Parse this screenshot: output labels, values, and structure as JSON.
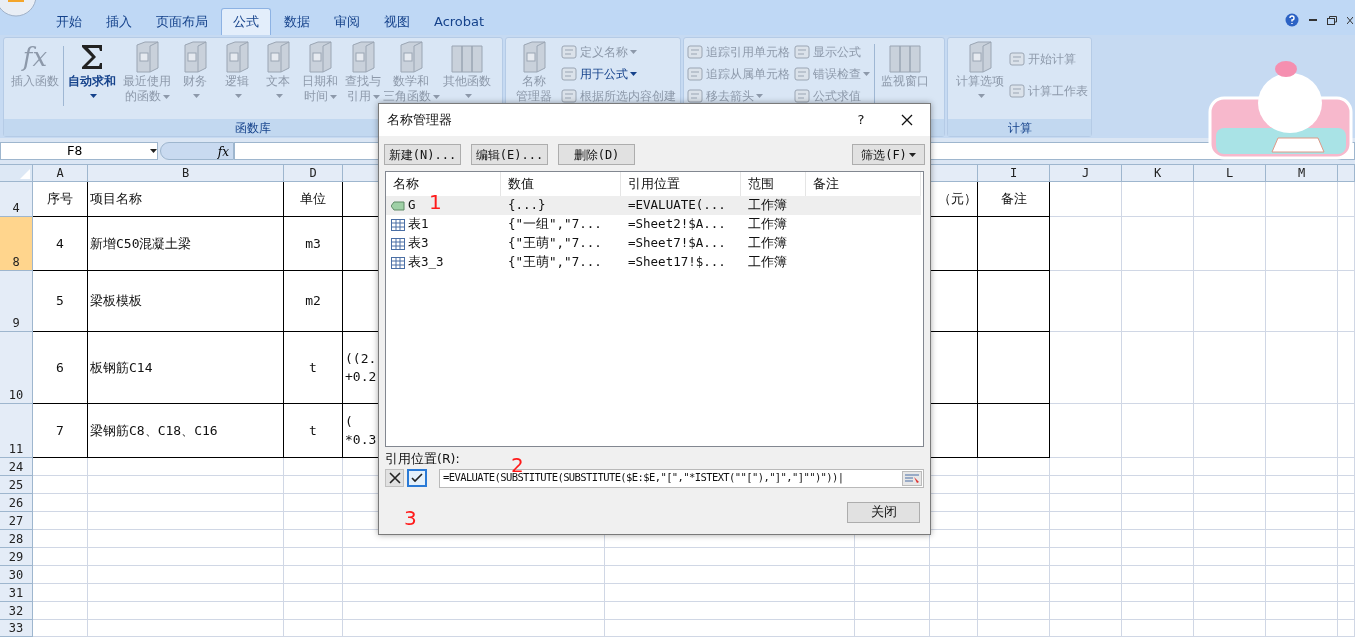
{
  "tabs": [
    {
      "label": "开始",
      "selected": false
    },
    {
      "label": "插入",
      "selected": false
    },
    {
      "label": "页面布局",
      "selected": false
    },
    {
      "label": "公式",
      "selected": true
    },
    {
      "label": "数据",
      "selected": false
    },
    {
      "label": "审阅",
      "selected": false
    },
    {
      "label": "视图",
      "selected": false
    },
    {
      "label": "Acrobat",
      "selected": false
    }
  ],
  "ribbon": {
    "library": {
      "label": "函数库",
      "buttons": [
        {
          "kind": "fx",
          "glyph": "fx",
          "lines": [
            "插入函数"
          ],
          "dropdown": false,
          "disabled": true
        },
        {
          "kind": "sigma",
          "lines": [
            "自动求和"
          ],
          "dropdown": true,
          "disabled": false
        },
        {
          "kind": "book",
          "lines": [
            "最近使用",
            "的函数"
          ],
          "dropdown": true,
          "disabled": true
        },
        {
          "kind": "book",
          "lines": [
            "财务"
          ],
          "dropdown": true,
          "disabled": true
        },
        {
          "kind": "book",
          "lines": [
            "逻辑"
          ],
          "dropdown": true,
          "disabled": true
        },
        {
          "kind": "book",
          "lines": [
            "文本"
          ],
          "dropdown": true,
          "disabled": true
        },
        {
          "kind": "book",
          "lines": [
            "日期和",
            "时间"
          ],
          "dropdown": true,
          "disabled": true
        },
        {
          "kind": "book",
          "lines": [
            "查找与",
            "引用"
          ],
          "dropdown": true,
          "disabled": true
        },
        {
          "kind": "book",
          "lines": [
            "数学和",
            "三角函数"
          ],
          "dropdown": true,
          "disabled": true
        },
        {
          "kind": "books",
          "lines": [
            "其他函数"
          ],
          "dropdown": true,
          "disabled": true
        }
      ]
    },
    "names": {
      "big": {
        "lines": [
          "名称",
          "管理器"
        ],
        "disabled": true
      },
      "items": [
        {
          "label": "定义名称",
          "dropdown": true,
          "disabled": true
        },
        {
          "label": "用于公式",
          "dropdown": true,
          "disabled": false
        },
        {
          "label": "根据所选内容创建",
          "dropdown": false,
          "disabled": true
        }
      ]
    },
    "audit": {
      "columns": [
        [
          {
            "label": "追踪引用单元格",
            "dropdown": false
          },
          {
            "label": "追踪从属单元格",
            "dropdown": false
          },
          {
            "label": "移去箭头",
            "dropdown": true
          }
        ],
        [
          {
            "label": "显示公式",
            "dropdown": false
          },
          {
            "label": "错误检查",
            "dropdown": true
          },
          {
            "label": "公式求值",
            "dropdown": false
          }
        ]
      ],
      "big": {
        "lines": [
          "监视窗口"
        ]
      }
    },
    "calc": {
      "label": "计算",
      "big": {
        "lines": [
          "计算选项"
        ],
        "dropdown": true
      },
      "items": [
        {
          "label": "开始计算"
        },
        {
          "label": "计算工作表"
        }
      ]
    }
  },
  "formula_bar": {
    "cell_ref": "F8",
    "fx": "fx"
  },
  "sheet": {
    "column_headers": [
      "A",
      "B",
      "D",
      "I",
      "J",
      "K",
      "L",
      "M"
    ],
    "rows": [
      {
        "header": "4",
        "selected": false,
        "cells": {
          "A": [
            "序号"
          ],
          "B": [
            "项目名称"
          ],
          "D": [
            "单位"
          ],
          "H": [
            "（元）"
          ],
          "I": [
            "备注"
          ]
        }
      },
      {
        "header": "8",
        "selected": true,
        "cells": {
          "A": [
            "4"
          ],
          "B": [
            "新增C50混凝土梁"
          ],
          "D": [
            "m3"
          ]
        }
      },
      {
        "header": "9",
        "selected": false,
        "cells": {
          "A": [
            "5"
          ],
          "B": [
            "梁板模板"
          ],
          "D": [
            "m2"
          ]
        }
      },
      {
        "header": "10",
        "selected": false,
        "cells": {
          "A": [
            "6"
          ],
          "B": [
            "板钢筋C14"
          ],
          "D": [
            "t"
          ],
          "E": [
            "((2.",
            "+0.2"
          ]
        }
      },
      {
        "header": "11",
        "selected": false,
        "cells": {
          "A": [
            "7"
          ],
          "B": [
            "梁钢筋C8、C18、C16"
          ],
          "D": [
            "t"
          ],
          "E": [
            "(",
            "*0.3"
          ]
        }
      },
      {
        "header": "24",
        "selected": false,
        "cells": {}
      },
      {
        "header": "25",
        "selected": false,
        "cells": {}
      },
      {
        "header": "26",
        "selected": false,
        "cells": {}
      },
      {
        "header": "27",
        "selected": false,
        "cells": {}
      },
      {
        "header": "28",
        "selected": false,
        "cells": {}
      },
      {
        "header": "29",
        "selected": false,
        "cells": {}
      },
      {
        "header": "30",
        "selected": false,
        "cells": {}
      },
      {
        "header": "31",
        "selected": false,
        "cells": {}
      },
      {
        "header": "32",
        "selected": false,
        "cells": {}
      },
      {
        "header": "33",
        "selected": false,
        "cells": {}
      }
    ]
  },
  "dialog": {
    "title": "名称管理器",
    "help": "?",
    "buttons": [
      "新建(N)...",
      "编辑(E)...",
      "删除(D)"
    ],
    "filter": "筛选(F)",
    "columns": [
      "名称",
      "数值",
      "引用位置",
      "范围",
      "备注"
    ],
    "rows": [
      {
        "kind": "name",
        "name": "G",
        "value": "{...}",
        "refers_to": "=EVALUATE(...",
        "scope": "工作簿",
        "selected": true
      },
      {
        "kind": "table",
        "name": "表1",
        "value": "{\"一组\",\"7...",
        "refers_to": "=Sheet2!$A...",
        "scope": "工作簿",
        "selected": false
      },
      {
        "kind": "table",
        "name": "表3",
        "value": "{\"王萌\",\"7...",
        "refers_to": "=Sheet7!$A...",
        "scope": "工作簿",
        "selected": false
      },
      {
        "kind": "table",
        "name": "表3_3",
        "value": "{\"王萌\",\"7...",
        "refers_to": "=Sheet17!$...",
        "scope": "工作簿",
        "selected": false
      }
    ],
    "refers_label": "引用位置(R):",
    "formula": "=EVALUATE(SUBSTITUTE(SUBSTITUTE($E:$E,\"[\",\"*ISTEXT(\"\"[\"),\"]\",\"]\"\")\"))|",
    "close": "关闭",
    "annotations": [
      "1",
      "2",
      "3"
    ]
  }
}
